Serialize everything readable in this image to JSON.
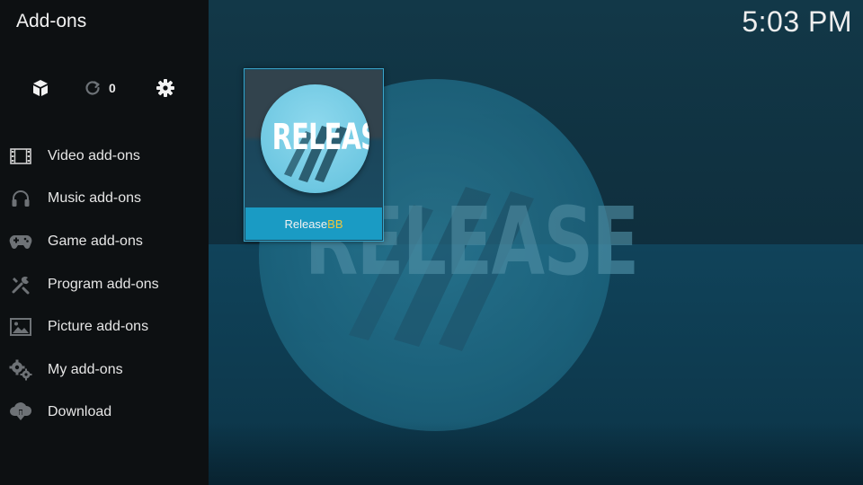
{
  "window": {
    "title": "Add-ons",
    "clock": "5:03 PM"
  },
  "toolbar": {
    "box_icon": "addon-box-icon",
    "update_icon": "refresh-icon",
    "update_count": "0",
    "settings_icon": "gear-icon"
  },
  "sidebar": {
    "items": [
      {
        "label": "Video add-ons",
        "icon": "film-icon"
      },
      {
        "label": "Music add-ons",
        "icon": "headphones-icon"
      },
      {
        "label": "Game add-ons",
        "icon": "gamepad-icon"
      },
      {
        "label": "Program add-ons",
        "icon": "tools-icon"
      },
      {
        "label": "Picture add-ons",
        "icon": "picture-icon"
      },
      {
        "label": "My add-ons",
        "icon": "gears-icon"
      },
      {
        "label": "Download",
        "icon": "cloud-download-icon"
      }
    ]
  },
  "addon": {
    "name_main": "Release",
    "name_accent": "BB",
    "art_text": "RELEASE"
  },
  "colors": {
    "accent": "#1a9bc4",
    "highlight": "#f0c53a",
    "sidebar": "#0d1012"
  }
}
